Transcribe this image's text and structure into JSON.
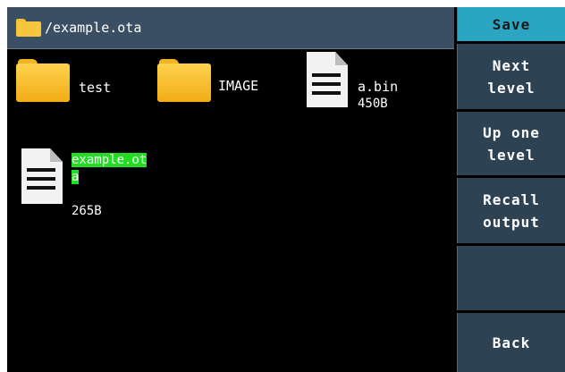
{
  "header": {
    "path": "/example.ota",
    "icon": "folder-icon"
  },
  "menu": {
    "items": [
      {
        "label": "Save",
        "active": true
      },
      {
        "label": "Next\nlevel",
        "active": false
      },
      {
        "label": "Up one\nlevel",
        "active": false
      },
      {
        "label": "Recall\noutput",
        "active": false
      },
      {
        "label": "",
        "active": false
      },
      {
        "label": "Back",
        "active": false
      }
    ]
  },
  "files": [
    {
      "name": "test",
      "type": "folder",
      "size": ""
    },
    {
      "name": "IMAGE",
      "type": "folder",
      "size": ""
    },
    {
      "name": "a.bin",
      "type": "file",
      "size": "450B"
    },
    {
      "name": "example.ota",
      "type": "file",
      "size": "265B",
      "selected": true
    }
  ],
  "colors": {
    "header_bg": "#3b4f64",
    "menu_bg": "#2d4253",
    "menu_active_bg": "#2aa6c3",
    "selection_bg": "#22dd22",
    "background": "#000000"
  }
}
